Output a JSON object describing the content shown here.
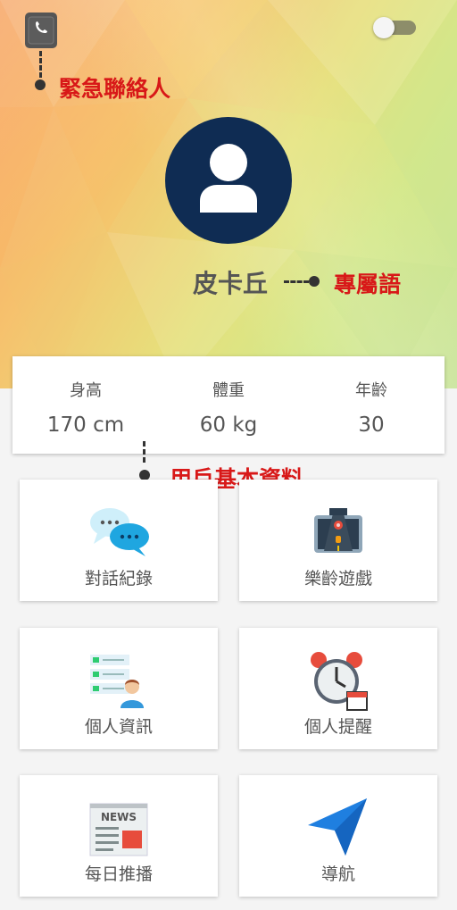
{
  "header": {
    "emergency_contact_icon": "phone-book-icon",
    "toggle_state": "off"
  },
  "annotations": {
    "emergency_contact": "緊急聯絡人",
    "exclusive_term": "專屬語",
    "user_basic_info": "用戶基本資料"
  },
  "profile": {
    "avatar_icon": "user-icon",
    "name": "皮卡丘"
  },
  "info": [
    {
      "label": "身高",
      "value": "170 cm"
    },
    {
      "label": "體重",
      "value": "60 kg"
    },
    {
      "label": "年齡",
      "value": "30"
    }
  ],
  "menu": [
    {
      "label": "對話紀錄",
      "icon": "chat-bubbles-icon"
    },
    {
      "label": "樂齡遊戲",
      "icon": "racing-game-icon"
    },
    {
      "label": "個人資訊",
      "icon": "personal-info-icon"
    },
    {
      "label": "個人提醒",
      "icon": "alarm-clock-icon"
    },
    {
      "label": "每日推播",
      "icon": "news-icon"
    },
    {
      "label": "導航",
      "icon": "navigation-arrow-icon"
    }
  ],
  "colors": {
    "annotation_red": "#d81818",
    "avatar_bg": "#0f2c53"
  }
}
